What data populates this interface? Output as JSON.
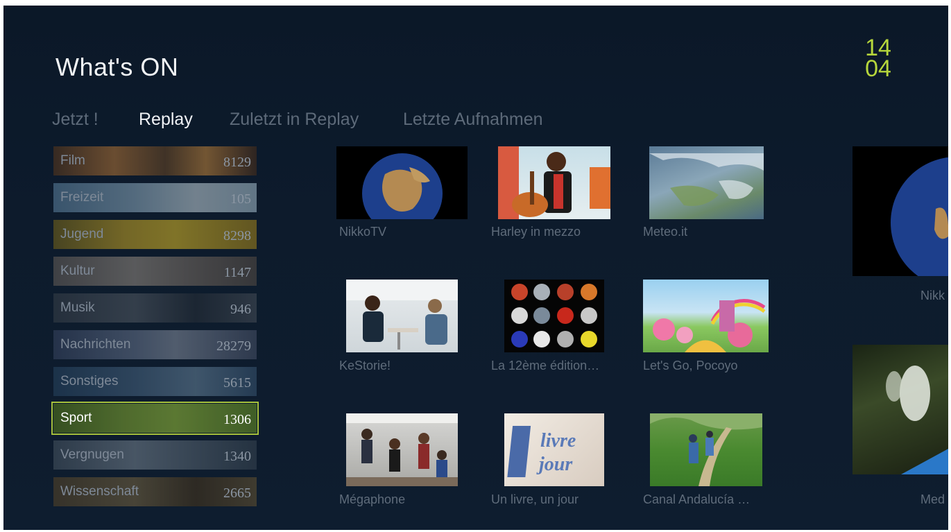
{
  "header": {
    "title": "What's ON",
    "clock_hour": "14",
    "clock_minute": "04"
  },
  "tabs": [
    {
      "label": "Jetzt !",
      "active": false
    },
    {
      "label": "Replay",
      "active": true
    },
    {
      "label": "Zuletzt in Replay",
      "active": false
    },
    {
      "label": "Letzte Aufnahmen",
      "active": false
    }
  ],
  "categories": [
    {
      "name": "Film",
      "count": "8129"
    },
    {
      "name": "Freizeit",
      "count": "105"
    },
    {
      "name": "Jugend",
      "count": "8298"
    },
    {
      "name": "Kultur",
      "count": "1147"
    },
    {
      "name": "Musik",
      "count": "946"
    },
    {
      "name": "Nachrichten",
      "count": "28279"
    },
    {
      "name": "Sonstiges",
      "count": "5615"
    },
    {
      "name": "Sport",
      "count": "1306",
      "selected": true
    },
    {
      "name": "Vergnugen",
      "count": "1340"
    },
    {
      "name": "Wissenschaft",
      "count": "2665"
    }
  ],
  "programs": [
    {
      "title": "NikkoTV",
      "image": "earth-globe"
    },
    {
      "title": "Harley in mezzo",
      "image": "boy-with-guitar"
    },
    {
      "title": "Meteo.it",
      "image": "satellite-weather-map"
    },
    {
      "title": "KeStorie!",
      "image": "people-talking"
    },
    {
      "title": "La 12ème édition…",
      "image": "sport-balls-grid"
    },
    {
      "title": "Let's Go, Pocoyo",
      "image": "candy-landscape"
    },
    {
      "title": "Mégaphone",
      "image": "band-rehearsal"
    },
    {
      "title": "Un livre, un jour",
      "image": "book-logo"
    },
    {
      "title": "Canal Andalucía …",
      "image": "hikers-trail"
    }
  ],
  "side_programs": [
    {
      "title": "Nikk",
      "image": "earth-globe"
    },
    {
      "title": "Med",
      "image": "flower-closeup"
    }
  ],
  "colors": {
    "accent": "#b6d63c",
    "background": "#0d1b2c",
    "text_dim": "#5f6c7b"
  }
}
